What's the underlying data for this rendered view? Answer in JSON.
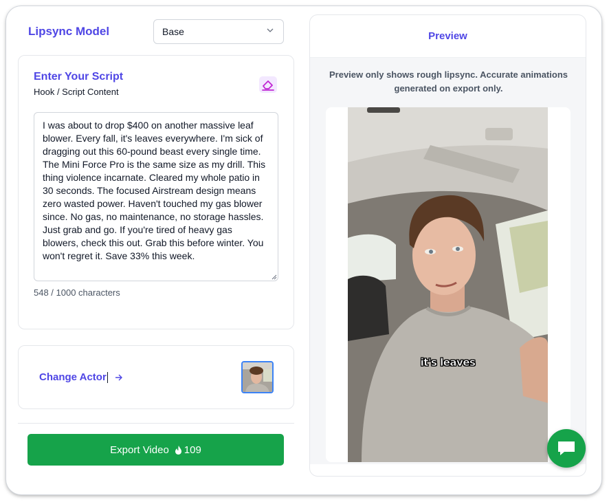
{
  "model": {
    "title": "Lipsync Model",
    "selected": "Base"
  },
  "script": {
    "title": "Enter Your Script",
    "subtitle": "Hook / Script Content",
    "content": "I was about to drop $400 on another massive leaf blower. Every fall, it's leaves everywhere. I'm sick of dragging out this 60-pound beast every single time. The Mini Force Pro is the same size as my drill. This thing violence incarnate. Cleared my whole patio in 30 seconds. The focused Airstream design means zero wasted power. Haven't touched my gas blower since. No gas, no maintenance, no storage hassles. Just grab and go. If you're tired of heavy gas blowers, check this out. Grab this before winter. You won't regret it. Save 33% this week.",
    "char_count": "548 / 1000 characters",
    "clear_icon": "eraser-icon"
  },
  "actor": {
    "change_label": "Change Actor",
    "arrow_icon": "arrow-right-icon"
  },
  "export": {
    "label": "Export Video",
    "credits": "109",
    "credit_icon": "flame-icon"
  },
  "preview": {
    "title": "Preview",
    "note": "Preview only shows rough lipsync. Accurate animations generated on export only.",
    "caption": "it's leaves"
  },
  "chat": {
    "icon": "chat-bubble-icon"
  },
  "colors": {
    "accent": "#4f46e5",
    "export_green": "#16a34a"
  }
}
